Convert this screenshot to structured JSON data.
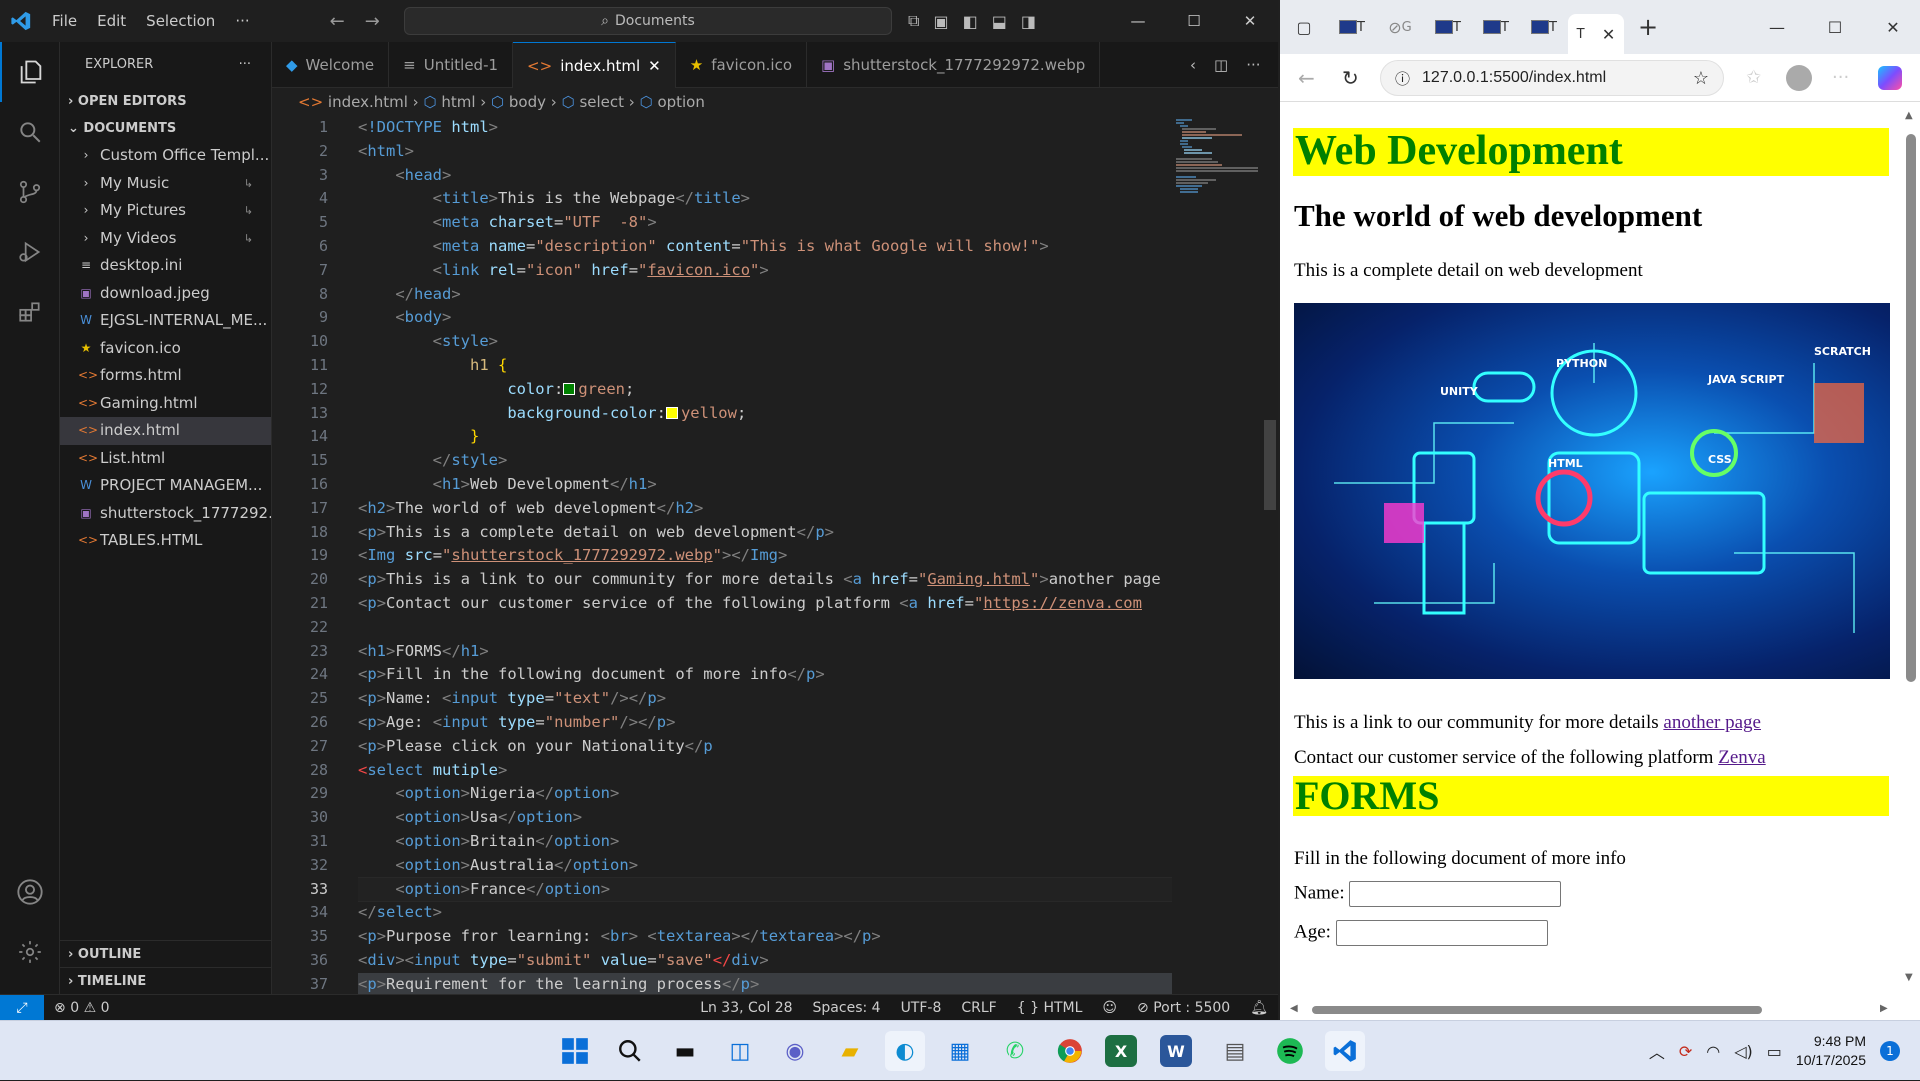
{
  "vscode": {
    "menu": [
      "File",
      "Edit",
      "Selection",
      "···"
    ],
    "command_center": "Documents",
    "explorer_title": "EXPLORER",
    "explorer_more": "···",
    "sections": {
      "open_editors": "OPEN EDITORS",
      "documents": "DOCUMENTS",
      "outline": "OUTLINE",
      "timeline": "TIMELINE"
    },
    "files": [
      {
        "name": "Custom Office Templ...",
        "kind": "folder"
      },
      {
        "name": "My Music",
        "kind": "folder"
      },
      {
        "name": "My Pictures",
        "kind": "folder"
      },
      {
        "name": "My Videos",
        "kind": "folder"
      },
      {
        "name": "desktop.ini",
        "kind": "settings"
      },
      {
        "name": "download.jpeg",
        "kind": "image"
      },
      {
        "name": "EJGSL-INTERNAL_ME...",
        "kind": "word"
      },
      {
        "name": "favicon.ico",
        "kind": "star"
      },
      {
        "name": "forms.html",
        "kind": "html"
      },
      {
        "name": "Gaming.html",
        "kind": "html"
      },
      {
        "name": "index.html",
        "kind": "html",
        "selected": true
      },
      {
        "name": "List.html",
        "kind": "html"
      },
      {
        "name": "PROJECT MANAGEM...",
        "kind": "word"
      },
      {
        "name": "shutterstock_1777292...",
        "kind": "image"
      },
      {
        "name": "TABLES.HTML",
        "kind": "html"
      }
    ],
    "tabs": [
      {
        "label": "Welcome",
        "icon": "vscode"
      },
      {
        "label": "Untitled-1",
        "icon": "lines"
      },
      {
        "label": "index.html",
        "icon": "html",
        "active": true
      },
      {
        "label": "favicon.ico",
        "icon": "star"
      },
      {
        "label": "shutterstock_1777292972.webp",
        "icon": "image"
      }
    ],
    "breadcrumbs": [
      "index.html",
      "html",
      "body",
      "select",
      "option"
    ],
    "current_line": 33,
    "status": {
      "errors": "0",
      "warnings": "0",
      "position": "Ln 33, Col 28",
      "spaces": "Spaces: 4",
      "encoding": "UTF-8",
      "eol": "CRLF",
      "language": "HTML",
      "port": "Port : 5500"
    }
  },
  "browser": {
    "url": "127.0.0.1:5500/index.html",
    "page": {
      "h1": "Web Development",
      "h2": "The world of web development",
      "p1": "This is a complete detail on web development",
      "p2_text": "This is a link to our community for more details ",
      "p2_link": "another page",
      "p3_text": "Contact our customer service of the following platform ",
      "p3_link": "Zenva",
      "h1_forms": "FORMS",
      "p4": "Fill in the following document of more info",
      "name_label": "Name: ",
      "age_label": "Age: "
    },
    "hero_labels": [
      "PYTHON",
      "UNITY",
      "JAVA SCRIPT",
      "SCRATCH",
      "HTML",
      "CSS"
    ]
  },
  "taskbar": {
    "time": "9:48 PM",
    "date": "10/17/2025",
    "notifications": "1"
  }
}
